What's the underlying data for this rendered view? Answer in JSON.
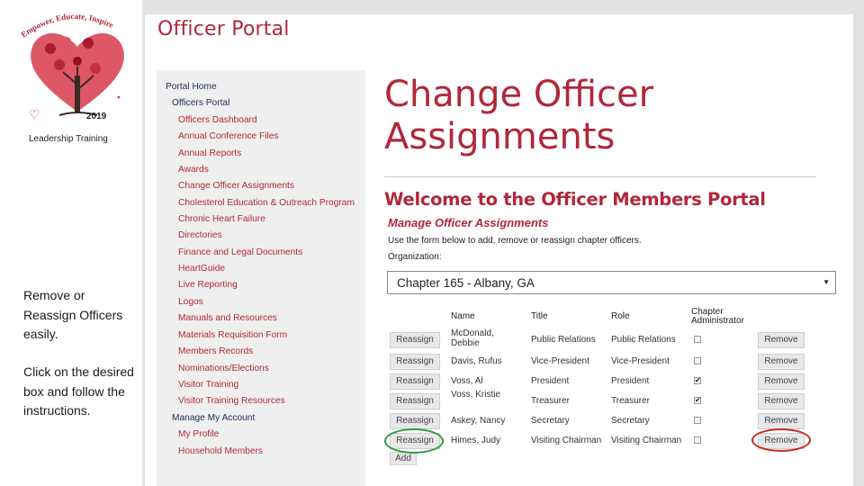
{
  "logo": {
    "arc_text": "Empower, Educate, Inspire",
    "year": "2019",
    "subtitle": "Leadership Training"
  },
  "notes": {
    "note1": "Remove or Reassign Officers easily.",
    "note2": "Click on the desired box and follow the instructions."
  },
  "portal_title": "Officer Portal",
  "sidebar": {
    "portal_home": "Portal Home",
    "officers_portal": "Officers Portal",
    "links": [
      "Officers Dashboard",
      "Annual Conference Files",
      "Annual Reports",
      "Awards",
      "Change Officer Assignments",
      "Cholesterol Education & Outreach Program",
      "Chronic Heart Failure",
      "Directories",
      "Finance and Legal Documents",
      "HeartGuide",
      "Live Reporting",
      "Logos",
      "Manuals and Resources",
      "Materials Requisition Form",
      "Members Records",
      "Nominations/Elections",
      "Visitor Training",
      "Visitor Training Resources"
    ],
    "manage_account": "Manage My Account",
    "account_links": [
      "My Profile",
      "Household Members"
    ]
  },
  "main": {
    "page_title": "Change Officer Assignments",
    "welcome": "Welcome to the Officer Members Portal",
    "section": "Manage Officer Assignments",
    "instructions": "Use the form below to add, remove or reassign chapter officers.",
    "org_label": "Organization:",
    "org_value": "Chapter 165 - Albany, GA",
    "headers": {
      "name": "Name",
      "title": "Title",
      "role": "Role",
      "admin": "Chapter Administrator"
    },
    "reassign_label": "Reassign",
    "remove_label": "Remove",
    "add_label": "Add",
    "rows": [
      {
        "name": "McDonald, Debbie",
        "title": "Public Relations",
        "role": "Public Relations",
        "admin": false
      },
      {
        "name": "Davis, Rufus",
        "title": "Vice-President",
        "role": "Vice-President",
        "admin": false
      },
      {
        "name": "Voss, Al",
        "title": "President",
        "role": "President",
        "admin": true
      },
      {
        "name": "Voss, Kristie",
        "title": "Treasurer",
        "role": "Treasurer",
        "admin": true
      },
      {
        "name": "Askey, Nancy",
        "title": "Secretary",
        "role": "Secretary",
        "admin": false
      },
      {
        "name": "Himes, Judy",
        "title": "Visiting Chairman",
        "role": "Visiting Chairman",
        "admin": false
      }
    ]
  },
  "colors": {
    "brand_red": "#b0283a",
    "nav_blue": "#1e2a55",
    "green_ring": "#2e9a3a",
    "red_ring": "#c62828"
  }
}
